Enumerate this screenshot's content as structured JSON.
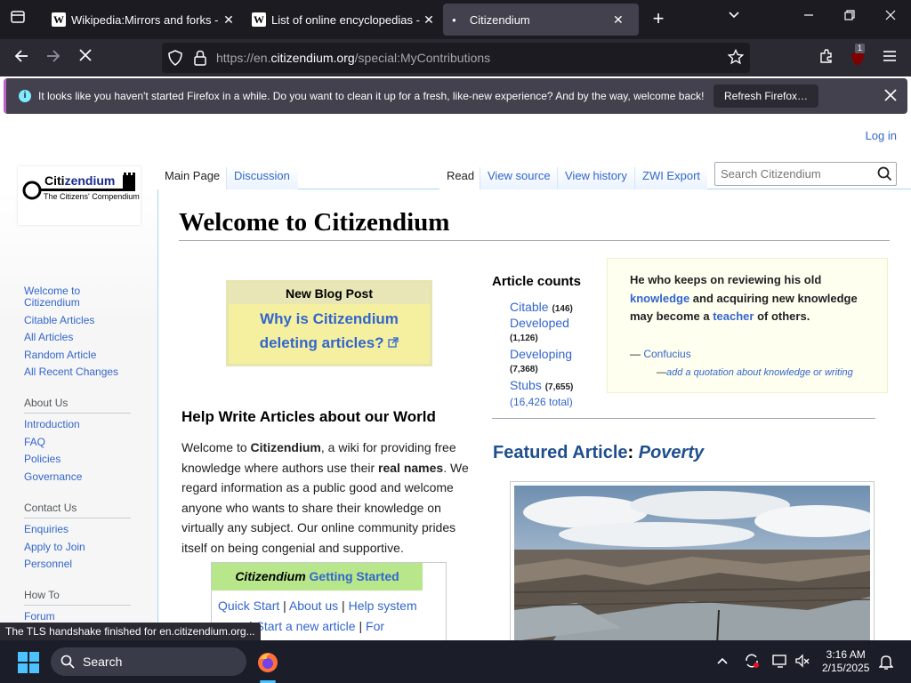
{
  "tabs": [
    {
      "title": "Wikipedia:Mirrors and forks - W",
      "fav": "W"
    },
    {
      "title": "List of online encyclopedias - W",
      "fav": "W"
    },
    {
      "title": "Citizendium",
      "fav": ""
    }
  ],
  "url": {
    "prefix": "https://en.",
    "domain": "citizendium.org",
    "path": "/special:MyContributions"
  },
  "extension_badge": "1",
  "notice": {
    "message": "It looks like you haven't started Firefox in a while. Do you want to clean it up for a fresh, like-new experience? And by the way, welcome back!",
    "button": "Refresh Firefox…"
  },
  "page": {
    "login": "Log in",
    "logo": {
      "name_a": "Citi",
      "name_b": "zendium",
      "tagline": "The Citizens' Compendium"
    },
    "tabs": {
      "main": "Main Page",
      "discussion": "Discussion",
      "read": "Read",
      "view_source": "View source",
      "view_history": "View history",
      "zwi_export": "ZWI Export"
    },
    "search_placeholder": "Search Citizendium",
    "title": "Welcome to Citizendium",
    "sidebar": {
      "nav": [
        "Welcome to Citizendium",
        "Citable Articles",
        "All Articles",
        "Random Article",
        "All Recent Changes"
      ],
      "about_heading": "About Us",
      "about": [
        "Introduction",
        "FAQ",
        "Policies",
        "Governance"
      ],
      "contact_heading": "Contact Us",
      "contact": [
        "Enquiries",
        "Apply to Join",
        "Personnel"
      ],
      "howto_heading": "How To",
      "howto": [
        "Forum"
      ]
    },
    "blog": {
      "heading": "New Blog Post",
      "link_line1": "Why is Citizendium",
      "link_line2": "deleting articles?"
    },
    "help": {
      "title": "Help Write Articles about our World",
      "p1": "Welcome to ",
      "p_bold1": "Citizendium",
      "p2": ", a wiki for providing free knowledge where authors use their ",
      "p_bold2": "real names",
      "p3": ". We regard information as a public good and welcome anyone who wants to share their knowledge on virtually any subject. Our online community prides itself on being congenial and supportive."
    },
    "getting_started": {
      "head_italic": "Citizendium",
      "head_link": "Getting Started",
      "line1": [
        "Quick Start",
        "About us",
        "Help system"
      ],
      "line2": [
        "Start a new article",
        "For"
      ]
    },
    "counts": {
      "title": "Article counts",
      "items": [
        {
          "label": "Citable",
          "count": "(146)"
        },
        {
          "label": "Developed",
          "count": "(1,126)"
        },
        {
          "label": "Developing",
          "count": "(7,368)"
        },
        {
          "label": "Stubs",
          "count": "(7,655)"
        }
      ],
      "total": "(16,426 total)"
    },
    "quote": {
      "t1": "He who keeps on reviewing his old ",
      "k1": "knowledge",
      "t2": " and acquiring new knowledge may become a ",
      "k2": "teacher",
      "t3": " of others.",
      "dash": "— ",
      "author": "Confucius",
      "add_dash": "—",
      "add": "add a quotation about knowledge or writing"
    },
    "featured": {
      "label": "Featured Article",
      "colon": ": ",
      "article": "Poverty"
    }
  },
  "status_tip": "The TLS handshake finished for en.citizendium.org...",
  "taskbar": {
    "search": "Search",
    "time": "3:16 AM",
    "date": "2/15/2025"
  }
}
